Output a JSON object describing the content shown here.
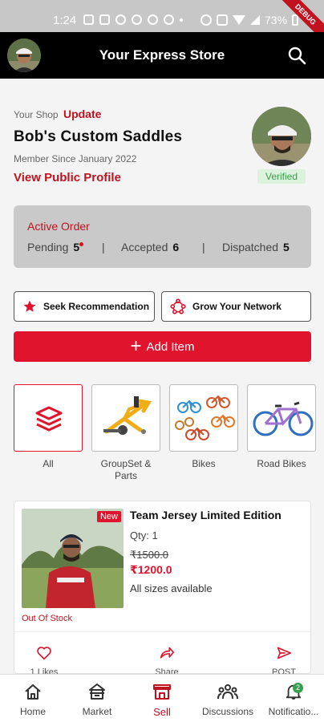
{
  "status_bar": {
    "time": "1:24",
    "battery": "73%",
    "debug_label": "DEBUG"
  },
  "app_bar": {
    "title": "Your Express Store",
    "search_icon": "search-icon"
  },
  "shop": {
    "label": "Your Shop",
    "update_label": "Update",
    "name": "Bob's Custom Saddles",
    "member_since": "Member Since January 2022",
    "profile_link": "View Public Profile",
    "verified": "Verified"
  },
  "orders": {
    "title": "Active Order",
    "pending_label": "Pending",
    "pending_count": "5",
    "accepted_label": "Accepted",
    "accepted_count": "6",
    "dispatched_label": "Dispatched",
    "dispatched_count": "5",
    "separator": "|"
  },
  "actions": {
    "seek_recommendation": "Seek Recommendation",
    "grow_network": "Grow Your Network",
    "add_item": "Add Item"
  },
  "categories": [
    {
      "label": "All",
      "icon": "layers-icon"
    },
    {
      "label": "GroupSet & Parts",
      "icon": "frame-icon"
    },
    {
      "label": "Bikes",
      "icon": "bikes-icon"
    },
    {
      "label": "Road Bikes",
      "icon": "road-bike-icon"
    }
  ],
  "product": {
    "badge": "New",
    "stock_status": "Out Of Stock",
    "title": "Team Jersey Limited Edition",
    "qty": "Qty: 1",
    "old_price": "₹1500.0",
    "price": "₹1200.0",
    "sizes": "All sizes available",
    "likes": "1 Likes",
    "share": "Share",
    "post": "POST"
  },
  "bottom_nav": [
    {
      "label": "Home",
      "icon": "home-icon"
    },
    {
      "label": "Market",
      "icon": "market-icon"
    },
    {
      "label": "Sell",
      "icon": "store-icon"
    },
    {
      "label": "Discussions",
      "icon": "people-icon"
    },
    {
      "label": "Notificatio...",
      "icon": "bell-icon",
      "badge": "2"
    }
  ],
  "colors": {
    "accent": "#e0142d",
    "verified": "#34a04b",
    "app_bar": "#000000"
  }
}
